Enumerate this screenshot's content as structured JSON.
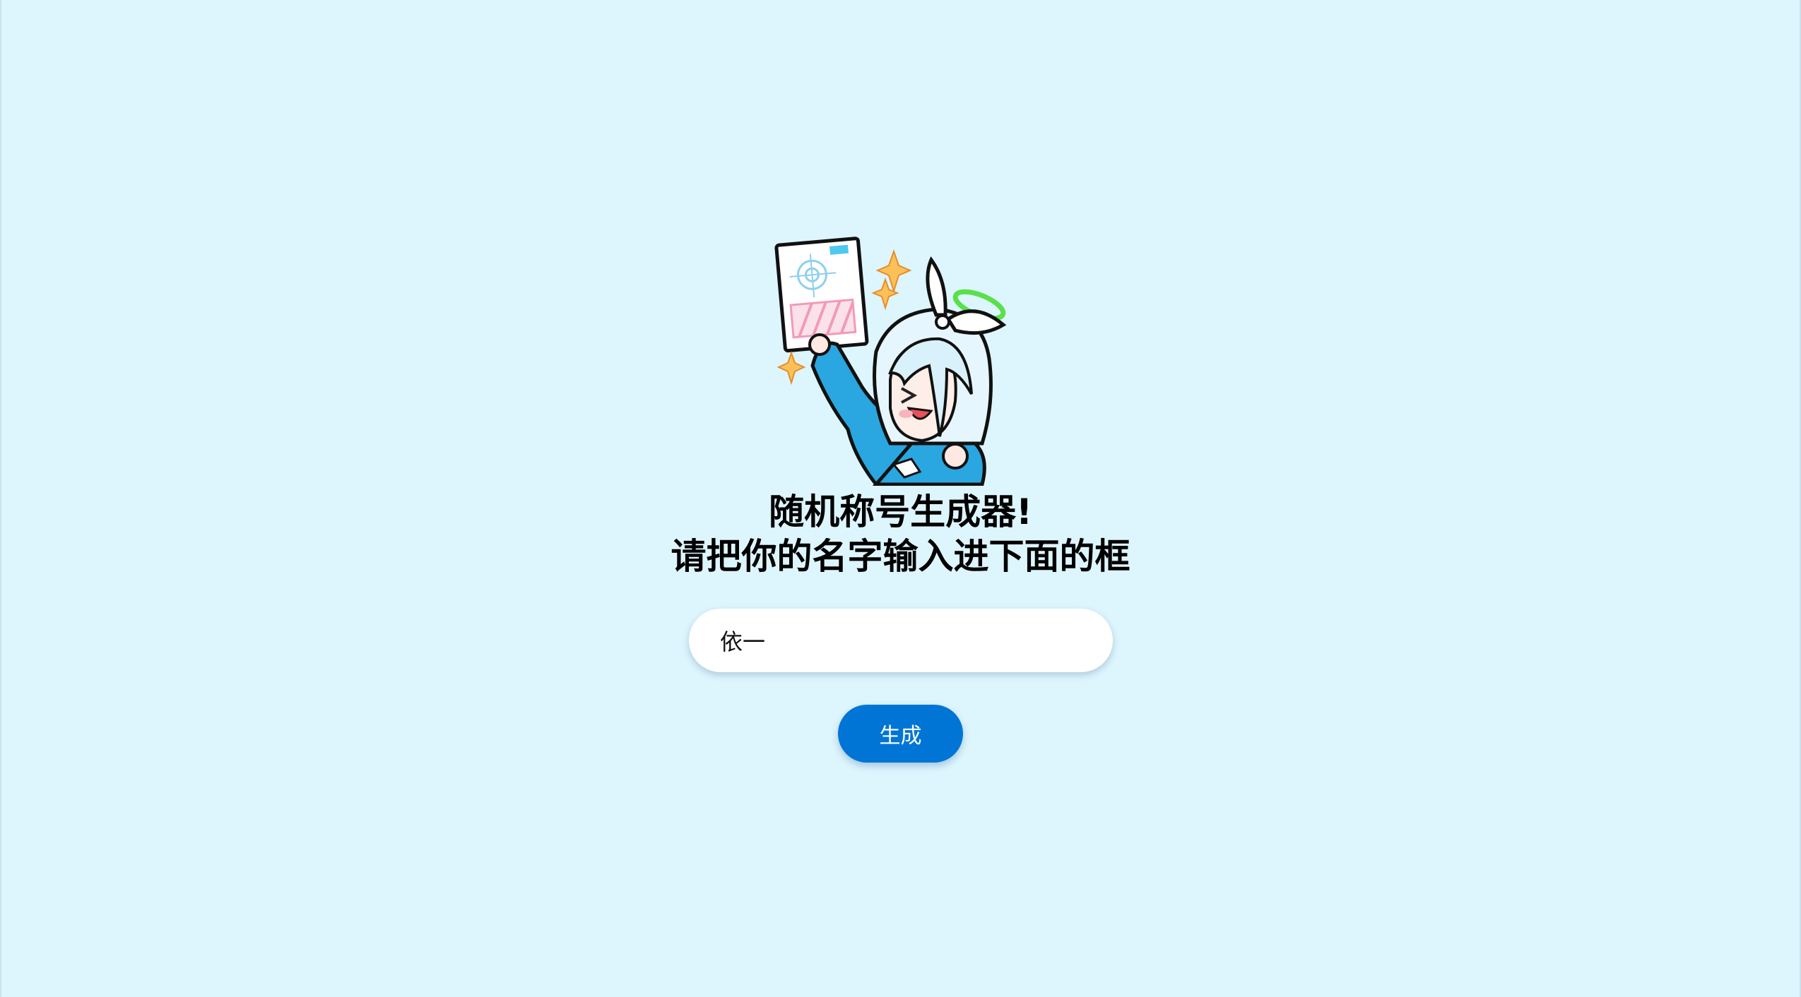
{
  "header": {
    "title_line1": "随机称号生成器!",
    "title_line2": "请把你的名字输入进下面的框"
  },
  "form": {
    "name_value": "依一",
    "generate_label": "生成"
  },
  "mascot": {
    "icon": "chibi-girl-holding-paper-illustration"
  },
  "colors": {
    "background": "#ddf5fd",
    "button": "#0175d6",
    "button_text": "#ffffff",
    "input_bg": "#ffffff",
    "title": "#000000"
  }
}
